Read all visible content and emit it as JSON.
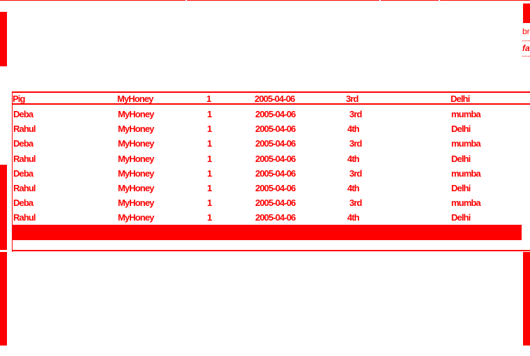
{
  "colors": {
    "accent": "#ff0000",
    "background": "#ffffff"
  },
  "sidebar_links": [
    {
      "label": "bru"
    },
    {
      "label": "fa"
    }
  ],
  "table": {
    "header": [
      "Pig",
      "MyHoney",
      "1",
      "2005-04-06",
      "3rd",
      "Delhi"
    ],
    "rows": [
      [
        "Deba",
        "MyHoney",
        "1",
        "2005-04-06",
        "3rd",
        "mumba"
      ],
      [
        "Rahul",
        "MyHoney",
        "1",
        "2005-04-06",
        "4th",
        "Delhi"
      ],
      [
        "Deba",
        "MyHoney",
        "1",
        "2005-04-06",
        "3rd",
        "mumba"
      ],
      [
        "Rahul",
        "MyHoney",
        "1",
        "2005-04-06",
        "4th",
        "Delhi"
      ],
      [
        "Deba",
        "MyHoney",
        "1",
        "2005-04-06",
        "3rd",
        "mumba"
      ],
      [
        "Rahul",
        "MyHoney",
        "1",
        "2005-04-06",
        "4th",
        "Delhi"
      ],
      [
        "Deba",
        "MyHoney",
        "1",
        "2005-04-06",
        "3rd",
        "mumba"
      ],
      [
        "Rahul",
        "MyHoney",
        "1",
        "2005-04-06",
        "4th",
        "Delhi"
      ]
    ]
  }
}
